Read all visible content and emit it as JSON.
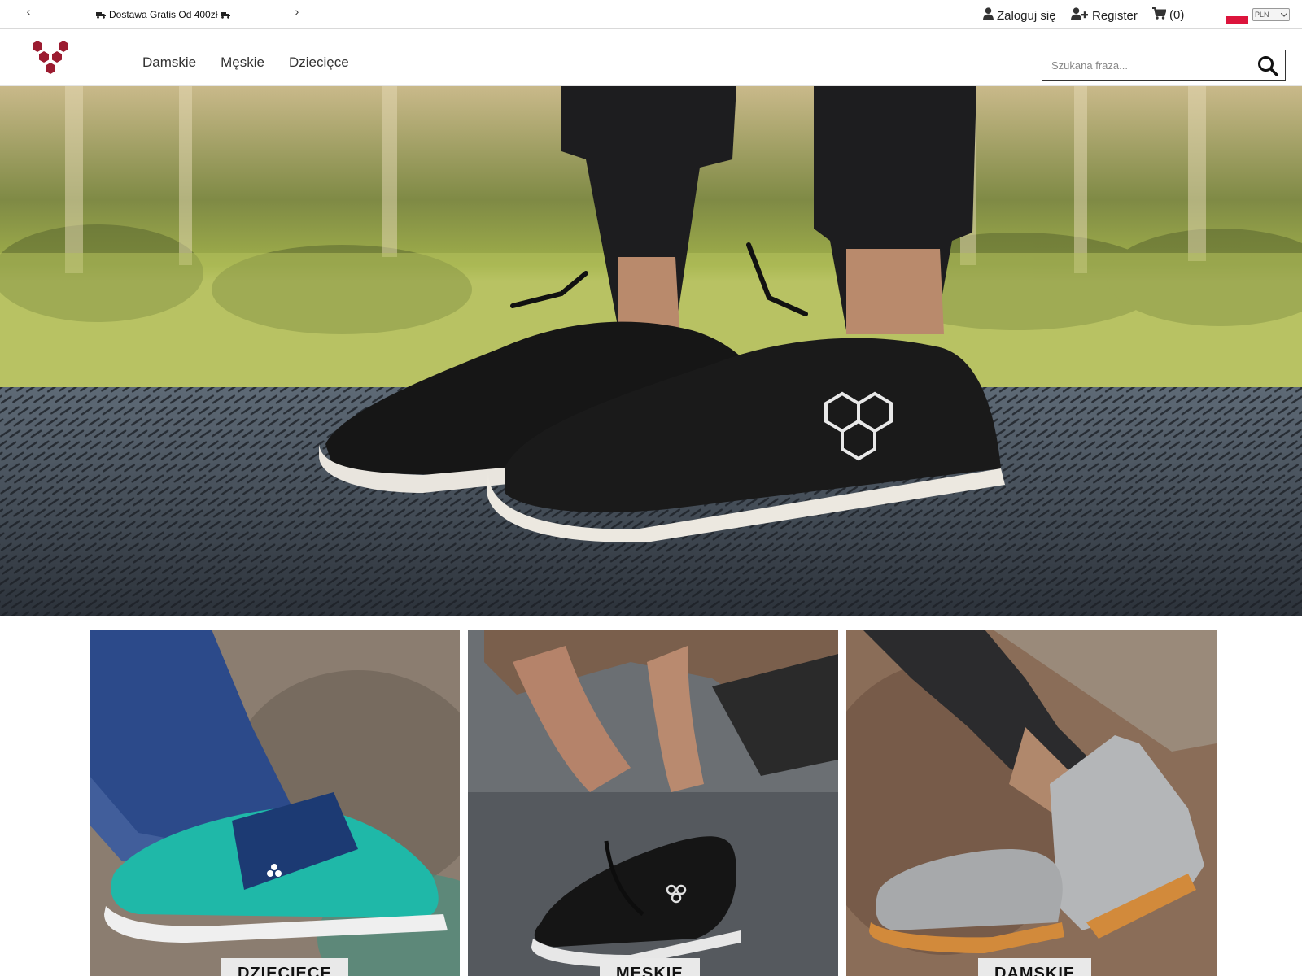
{
  "topbar": {
    "prev_arrow": "‹",
    "next_arrow": "›",
    "promo_text": "Dostawa Gratis Od 400zł",
    "login_label": "Zaloguj się",
    "register_label": "Register",
    "cart_count": "(0)",
    "currency": "PLN"
  },
  "header": {
    "nav": [
      "Damskie",
      "Męskie",
      "Dziecięce"
    ],
    "search_placeholder": "Szukana fraza..."
  },
  "categories": [
    {
      "label": "DZIECIĘCE"
    },
    {
      "label": "MĘSKIE"
    },
    {
      "label": "DAMSKIE"
    }
  ],
  "colors": {
    "brand": "#9b1b30",
    "flag_red": "#dc143c"
  },
  "icons": {
    "truck": "truck-icon",
    "user": "user-icon",
    "user_plus": "user-plus-icon",
    "cart": "cart-icon",
    "search": "search-icon"
  }
}
